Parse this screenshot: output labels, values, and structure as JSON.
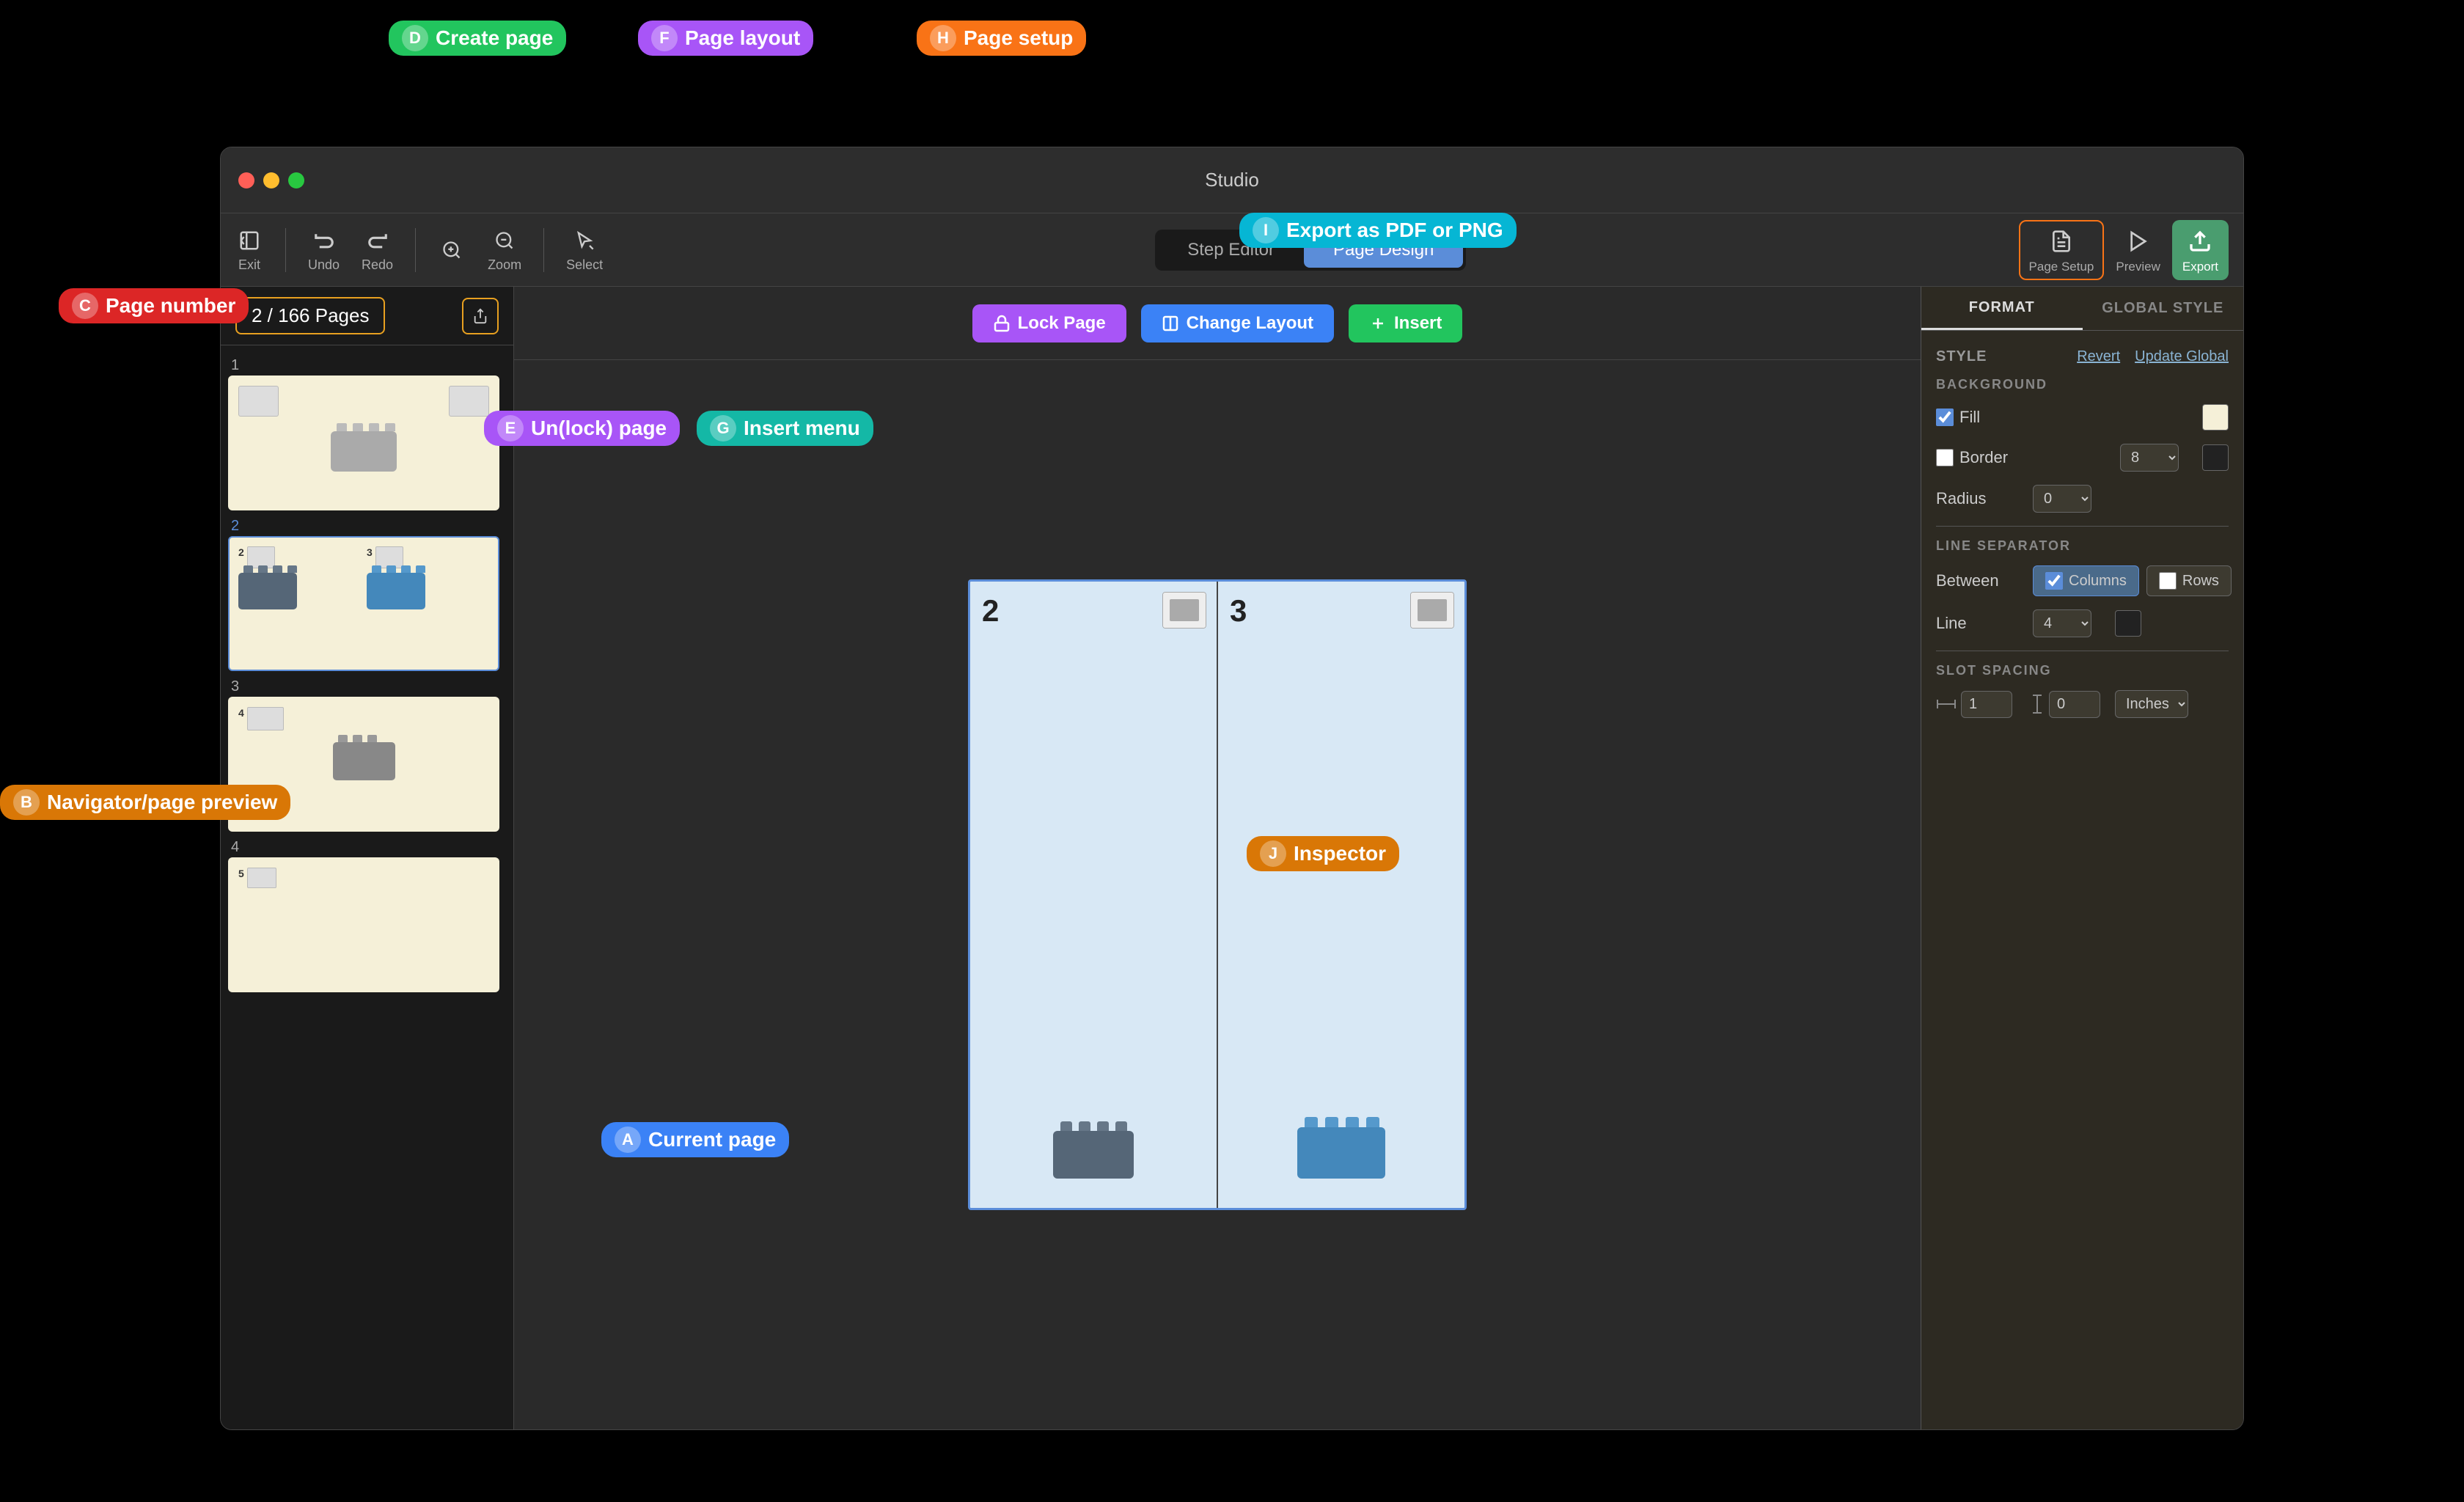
{
  "window": {
    "title": "Studio",
    "traffic_lights": [
      "red",
      "yellow",
      "green"
    ]
  },
  "toolbar": {
    "exit_label": "Exit",
    "undo_label": "Undo",
    "redo_label": "Redo",
    "zoom_label": "Zoom",
    "select_label": "Select",
    "tab_step_editor": "Step Editor",
    "tab_page_design": "Page Design",
    "page_setup_label": "Page Setup",
    "preview_label": "Preview",
    "export_label": "Export"
  },
  "page_nav": {
    "current": "2",
    "total": "166",
    "counter_text": "2 / 166 Pages"
  },
  "page_toolbar": {
    "lock_label": "Lock Page",
    "layout_label": "Change Layout",
    "insert_label": "Insert"
  },
  "canvas": {
    "slots": [
      {
        "number": "2",
        "has_content": true
      },
      {
        "number": "3",
        "has_content": true
      }
    ]
  },
  "inspector": {
    "tab_format": "FORMAT",
    "tab_global_style": "GLOBAL STYLE",
    "style_label": "STYLE",
    "revert_label": "Revert",
    "update_global_label": "Update Global",
    "background_label": "BACKGROUND",
    "fill_label": "Fill",
    "border_label": "Border",
    "border_value": "8",
    "radius_label": "Radius",
    "radius_value": "0",
    "line_separator_label": "LINE SEPARATOR",
    "between_label": "Between",
    "columns_label": "Columns",
    "rows_label": "Rows",
    "line_label": "Line",
    "line_value": "4",
    "slot_spacing_label": "SLOT SPACING",
    "h_spacing_value": "1",
    "v_spacing_value": "0",
    "spacing_unit": "Inches"
  },
  "annotations": {
    "a": {
      "letter": "A",
      "text": "Current page"
    },
    "b": {
      "letter": "B",
      "text": "Navigator/page preview"
    },
    "c": {
      "letter": "C",
      "text": "Page number"
    },
    "d": {
      "letter": "D",
      "text": "Create page"
    },
    "e": {
      "letter": "E",
      "text": "Un(lock) page"
    },
    "f": {
      "letter": "F",
      "text": "Page layout"
    },
    "g": {
      "letter": "G",
      "text": "Insert menu"
    },
    "h": {
      "letter": "H",
      "text": "Page setup"
    },
    "i": {
      "letter": "I",
      "text": "Export as PDF or PNG"
    },
    "j": {
      "letter": "J",
      "text": "Inspector"
    }
  }
}
